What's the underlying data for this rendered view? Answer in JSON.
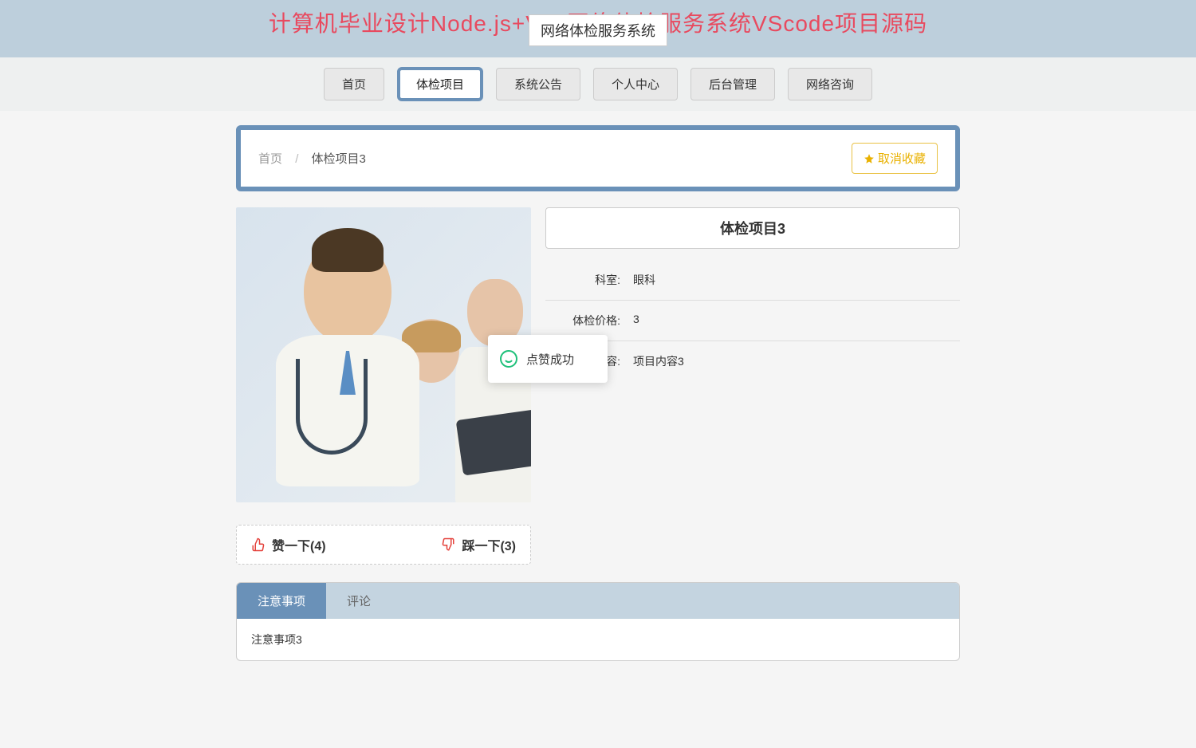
{
  "banner": {
    "title": "计算机毕业设计Node.js+Vue网络体检服务系统VScode项目源码",
    "sub": "网络体检服务系统"
  },
  "nav": {
    "items": [
      "首页",
      "体检项目",
      "系统公告",
      "个人中心",
      "后台管理",
      "网络咨询"
    ],
    "activeIndex": 1
  },
  "breadcrumb": {
    "home": "首页",
    "sep": "/",
    "current": "体检项目3"
  },
  "fav": {
    "label": "取消收藏"
  },
  "detail": {
    "title": "体检项目3",
    "rows": [
      {
        "label": "科室:",
        "value": "眼科"
      },
      {
        "label": "体检价格:",
        "value": "3"
      },
      {
        "label": "项目内容:",
        "value": "项目内容3"
      }
    ]
  },
  "vote": {
    "up": "赞一下(4)",
    "down": "踩一下(3)"
  },
  "tabs": {
    "items": [
      "注意事项",
      "评论"
    ],
    "activeIndex": 0,
    "content": "注意事项3"
  },
  "toast": {
    "text": "点赞成功"
  },
  "colors": {
    "accent": "#6a91b8",
    "danger": "#e84a5f",
    "warn": "#e9b100",
    "success": "#1ec07a"
  }
}
